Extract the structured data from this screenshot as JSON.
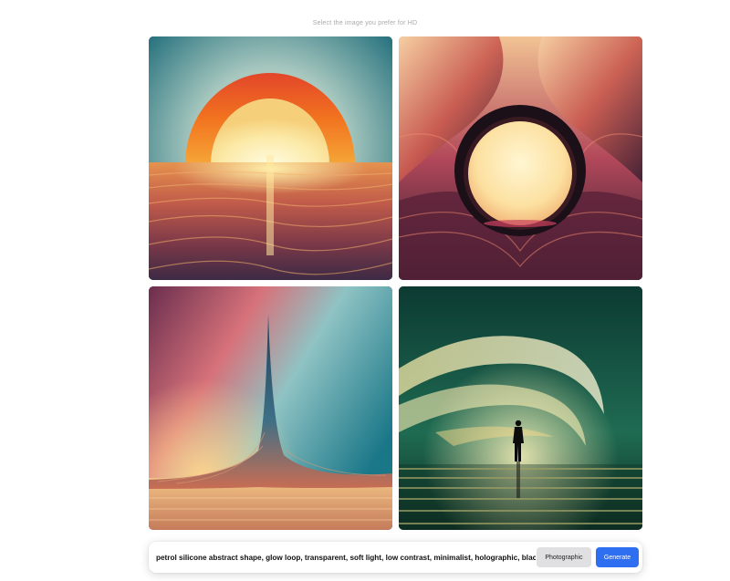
{
  "header": {
    "instruction": "Select the image you prefer for HD"
  },
  "images": [
    {
      "name": "sunset-arch-image",
      "selectable": true
    },
    {
      "name": "glowing-ring-image",
      "selectable": true
    },
    {
      "name": "spire-wave-image",
      "selectable": true
    },
    {
      "name": "silhouette-aurora-image",
      "selectable": true
    }
  ],
  "prompt_bar": {
    "prompt_value": "petrol silicone abstract shape, glow loop, transparent, soft light, low contrast, minimalist, holographic, black background",
    "style_label": "Photographic",
    "generate_label": "Generate"
  },
  "colors": {
    "accent": "#2e6ff2",
    "style_button_bg": "#e0e0e2",
    "instruction_text": "#a9a9a9"
  }
}
